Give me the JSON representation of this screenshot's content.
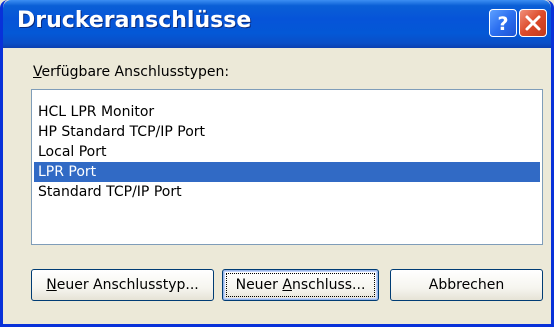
{
  "window": {
    "title": "Druckeranschlüsse",
    "help_button": "?",
    "close_button": "X"
  },
  "label": {
    "prefix": "V",
    "rest": "erfügbare Anschlusstypen:"
  },
  "list": {
    "items": [
      "HCL LPR Monitor",
      "HP Standard TCP/IP Port",
      "Local Port",
      "LPR Port",
      "Standard TCP/IP Port"
    ],
    "selected": "LPR Port"
  },
  "buttons": {
    "new_type": {
      "mnemonic": "N",
      "rest": "euer Anschlusstyp..."
    },
    "new_port": {
      "before": "Neuer ",
      "mnemonic": "A",
      "rest": "nschluss..."
    },
    "cancel": "Abbrechen"
  },
  "colors": {
    "title_bar": "#0654d8",
    "selection": "#316ac5",
    "dialog_bg": "#ece9d8"
  }
}
